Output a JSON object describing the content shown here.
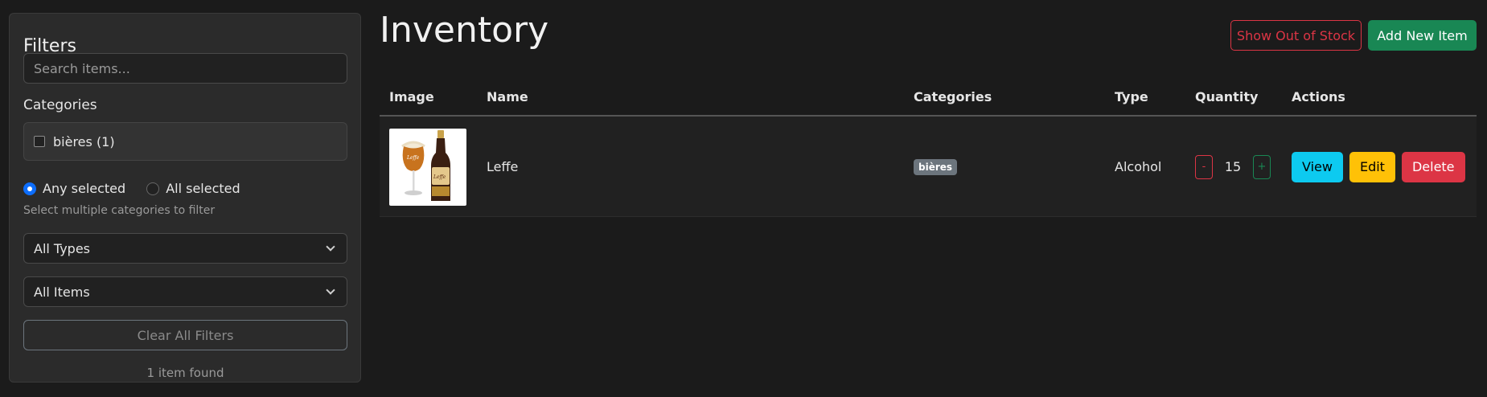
{
  "sidebar": {
    "title": "Filters",
    "search": {
      "placeholder": "Search items...",
      "value": ""
    },
    "categories_heading": "Categories",
    "categories": [
      {
        "label": "bières (1)",
        "checked": false
      }
    ],
    "match_mode": {
      "any_label": "Any selected",
      "all_label": "All selected",
      "selected": "any"
    },
    "hint": "Select multiple categories to filter",
    "type_select": "All Types",
    "items_select": "All Items",
    "clear_label": "Clear All Filters",
    "result_count": "1 item found"
  },
  "main": {
    "title": "Inventory",
    "show_out_of_stock_label": "Show Out of Stock",
    "add_new_label": "Add New Item",
    "table": {
      "headers": {
        "image": "Image",
        "name": "Name",
        "categories": "Categories",
        "type": "Type",
        "quantity": "Quantity",
        "actions": "Actions"
      },
      "rows": [
        {
          "name": "Leffe",
          "category": "bières",
          "type": "Alcohol",
          "quantity": "15",
          "minus_label": "-",
          "plus_label": "+",
          "view_label": "View",
          "edit_label": "Edit",
          "delete_label": "Delete",
          "image_logo_text": "Leffe"
        }
      ]
    }
  },
  "colors": {
    "background": "#1b1b1b",
    "panel": "#2b2b2b",
    "danger": "#dc3545",
    "success": "#198754",
    "info": "#0dcaf0",
    "warning": "#ffc107",
    "primary": "#0d6efd",
    "badge": "#6c757d"
  },
  "icons": {
    "select_arrow": "chevron-down-icon",
    "thumbnail": "beer-bottle-and-glass-image"
  }
}
